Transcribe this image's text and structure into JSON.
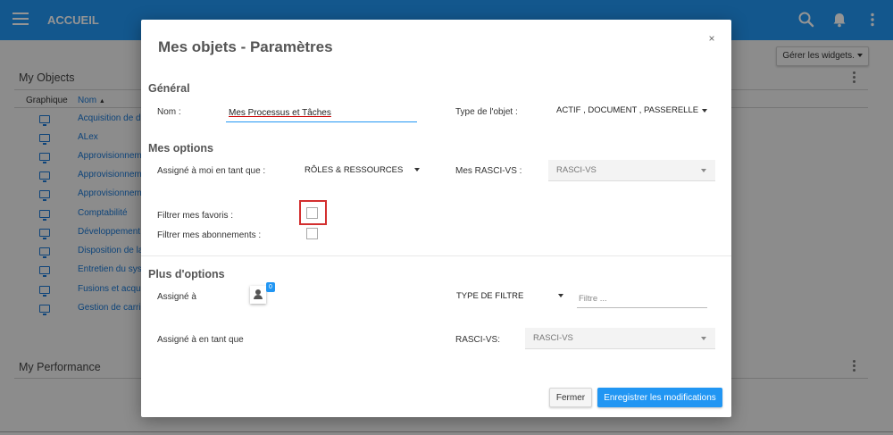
{
  "topbar": {
    "title": "ACCUEIL",
    "icons": [
      "menu-icon",
      "search-icon",
      "bell-icon",
      "more-vert-icon"
    ]
  },
  "background": {
    "widgets_button": "Gérer les widgets.",
    "my_objects": {
      "title": "My Objects",
      "columns": [
        "Graphique",
        "Nom"
      ],
      "rows": [
        "Acquisition de de",
        "ALex",
        "Approvisionneme",
        "Approvisionneme",
        "Approvisionneme",
        "Comptabilité",
        "Développement d",
        "Disposition de la",
        "Entretien du syst",
        "Fusions et acquis",
        "Gestion de carriè"
      ]
    },
    "my_performance": {
      "title": "My Performance"
    }
  },
  "modal": {
    "title": "Mes objets - Paramètres",
    "close": "×",
    "general": {
      "heading": "Général",
      "name_label": "Nom :",
      "name_value": "Mes Processus et Tâches",
      "type_label": "Type de l'objet :",
      "type_value": "ACTIF , DOCUMENT , PASSERELLE , IN"
    },
    "options": {
      "heading": "Mes options",
      "assigned_label": "Assigné à moi en tant que :",
      "assigned_value": "RÔLES & RESSOURCES",
      "rasci_label": "Mes RASCI-VS :",
      "rasci_value": "RASCI-VS",
      "favorites_label": "Filtrer mes favoris :",
      "favorites_checked": false,
      "subscriptions_label": "Filtrer mes abonnements :",
      "subscriptions_checked": false
    },
    "more_options": {
      "heading": "Plus d'options",
      "assigned_to_label": "Assigné à",
      "assigned_count": "0",
      "filter_type": "TYPE DE FILTRE",
      "filter_placeholder": "Filtre ...",
      "assigned_as_label": "Assigné à en tant que",
      "rasci_label": "RASCI-VS:",
      "rasci_value": "RASCI-VS"
    },
    "buttons": {
      "close": "Fermer",
      "save": "Enregistrer les modifications"
    }
  },
  "colors": {
    "primary": "#2196f3",
    "highlight": "#d32f2f",
    "link": "#1976d2"
  }
}
